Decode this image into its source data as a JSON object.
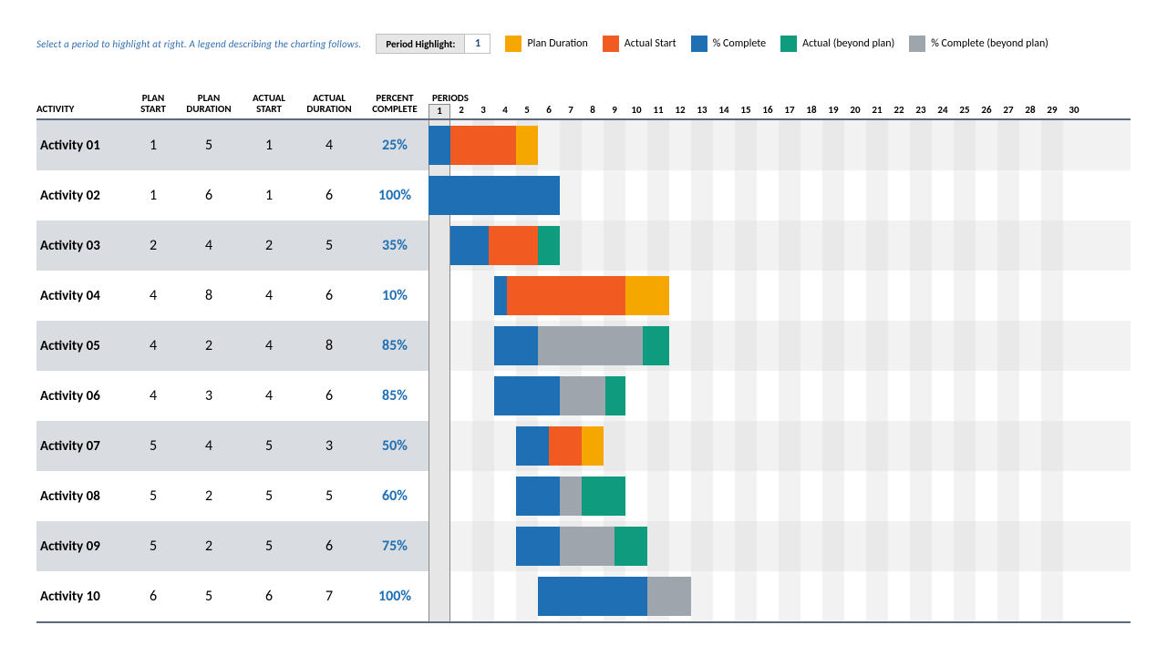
{
  "hint": "Select a period to highlight at right.  A legend describing the charting follows.",
  "period_highlight_label": "Period Highlight:",
  "period_highlight_value": "1",
  "legend": {
    "plan": "Plan Duration",
    "actual": "Actual Start",
    "complete": "% Complete",
    "beyond": "Actual (beyond plan)",
    "cbeyond": "% Complete (beyond plan)"
  },
  "headers": {
    "activity": "ACTIVITY",
    "plan_start": "PLAN START",
    "plan_duration": "PLAN DURATION",
    "actual_start": "ACTUAL START",
    "actual_duration": "ACTUAL DURATION",
    "percent_complete": "PERCENT COMPLETE",
    "periods": "PERIODS"
  },
  "period_count": 30,
  "highlight_period": 1,
  "colors": {
    "plan": "#f5a700",
    "actual": "#f15b21",
    "complete": "#1f6fb5",
    "beyond": "#0f9b7e",
    "cbeyond": "#9ea5ad"
  },
  "rows": [
    {
      "activity": "Activity 01",
      "ps": 1,
      "pd": 5,
      "as": 1,
      "ad": 4,
      "pc": "25%"
    },
    {
      "activity": "Activity 02",
      "ps": 1,
      "pd": 6,
      "as": 1,
      "ad": 6,
      "pc": "100%"
    },
    {
      "activity": "Activity 03",
      "ps": 2,
      "pd": 4,
      "as": 2,
      "ad": 5,
      "pc": "35%"
    },
    {
      "activity": "Activity 04",
      "ps": 4,
      "pd": 8,
      "as": 4,
      "ad": 6,
      "pc": "10%"
    },
    {
      "activity": "Activity 05",
      "ps": 4,
      "pd": 2,
      "as": 4,
      "ad": 8,
      "pc": "85%"
    },
    {
      "activity": "Activity 06",
      "ps": 4,
      "pd": 3,
      "as": 4,
      "ad": 6,
      "pc": "85%"
    },
    {
      "activity": "Activity 07",
      "ps": 5,
      "pd": 4,
      "as": 5,
      "ad": 3,
      "pc": "50%"
    },
    {
      "activity": "Activity 08",
      "ps": 5,
      "pd": 2,
      "as": 5,
      "ad": 5,
      "pc": "60%"
    },
    {
      "activity": "Activity 09",
      "ps": 5,
      "pd": 2,
      "as": 5,
      "ad": 6,
      "pc": "75%"
    },
    {
      "activity": "Activity 10",
      "ps": 6,
      "pd": 5,
      "as": 6,
      "ad": 7,
      "pc": "100%"
    }
  ],
  "chart_data": {
    "type": "bar",
    "title": "",
    "xlabel": "PERIODS",
    "ylabel": "ACTIVITY",
    "x": [
      1,
      2,
      3,
      4,
      5,
      6,
      7,
      8,
      9,
      10,
      11,
      12,
      13,
      14,
      15,
      16,
      17,
      18,
      19,
      20,
      21,
      22,
      23,
      24,
      25,
      26,
      27,
      28,
      29,
      30
    ],
    "xlim": [
      1,
      30
    ],
    "categories": [
      "Activity 01",
      "Activity 02",
      "Activity 03",
      "Activity 04",
      "Activity 05",
      "Activity 06",
      "Activity 07",
      "Activity 08",
      "Activity 09",
      "Activity 10"
    ],
    "series": [
      {
        "name": "Plan Start",
        "values": [
          1,
          1,
          2,
          4,
          4,
          4,
          5,
          5,
          5,
          6
        ]
      },
      {
        "name": "Plan Duration",
        "values": [
          5,
          6,
          4,
          8,
          2,
          3,
          4,
          2,
          2,
          5
        ]
      },
      {
        "name": "Actual Start",
        "values": [
          1,
          1,
          2,
          4,
          4,
          4,
          5,
          5,
          5,
          6
        ]
      },
      {
        "name": "Actual Duration",
        "values": [
          4,
          6,
          5,
          6,
          8,
          6,
          3,
          5,
          6,
          7
        ]
      },
      {
        "name": "% Complete",
        "values": [
          25,
          100,
          35,
          10,
          85,
          85,
          50,
          60,
          75,
          100
        ]
      }
    ],
    "legend": [
      "Plan Duration",
      "Actual Start",
      "% Complete",
      "Actual (beyond plan)",
      "% Complete (beyond plan)"
    ]
  }
}
